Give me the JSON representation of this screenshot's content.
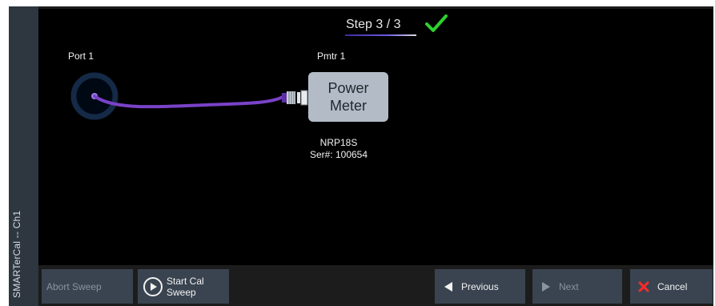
{
  "window": {
    "side_label": "SMARTerCal -- Ch1"
  },
  "wizard": {
    "step_text": "Step 3 / 3",
    "step_status_icon": "green-checkmark-icon"
  },
  "diagram": {
    "port_label": "Port 1",
    "power_meter_label": "Pmtr 1",
    "power_meter_text_line1": "Power",
    "power_meter_text_line2": "Meter",
    "model": "NRP18S",
    "serial": "Ser#: 100654",
    "colors": {
      "cable": "#7a42c8",
      "port_ring": "#142a46",
      "meter_body": "#b3bcc6"
    }
  },
  "toolbar": {
    "abort_label": "Abort Sweep",
    "start_label_line1": "Start Cal",
    "start_label_line2": "Sweep",
    "previous_label": "Previous",
    "next_label": "Next",
    "cancel_label": "Cancel"
  }
}
